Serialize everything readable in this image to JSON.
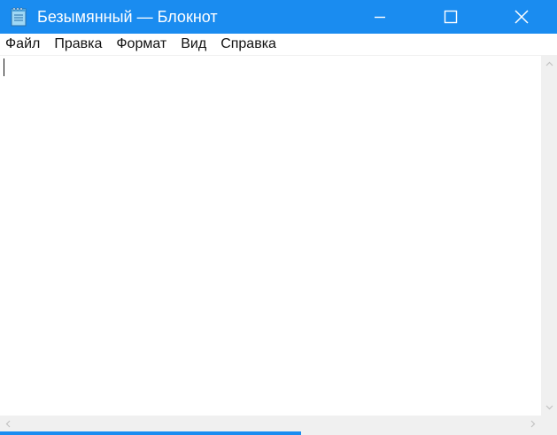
{
  "window": {
    "title": "Безымянный — Блокнот",
    "accent_color": "#1a8cf0"
  },
  "icons": {
    "app": "notepad-icon",
    "minimize": "minimize-icon",
    "maximize": "maximize-icon",
    "close": "close-icon"
  },
  "menu": {
    "items": [
      {
        "label": "Файл"
      },
      {
        "label": "Правка"
      },
      {
        "label": "Формат"
      },
      {
        "label": "Вид"
      },
      {
        "label": "Справка"
      }
    ]
  },
  "editor": {
    "text": ""
  }
}
